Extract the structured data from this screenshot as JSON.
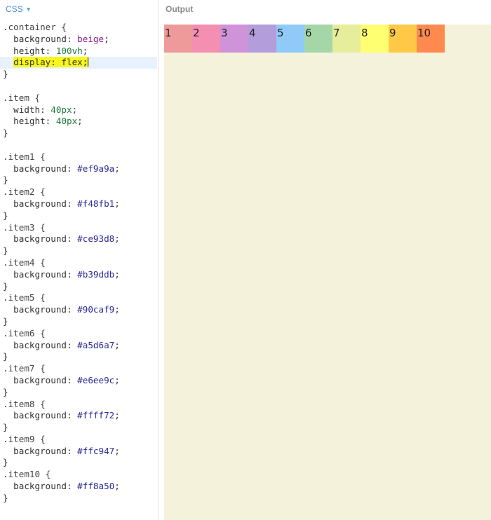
{
  "editor": {
    "tab_label": "CSS",
    "lines": [
      [
        {
          "t": ".container {",
          "c": "sel"
        }
      ],
      [
        {
          "t": "  background: ",
          "c": "prop"
        },
        {
          "t": "beige",
          "c": "val"
        },
        {
          "t": ";",
          "c": "prop"
        }
      ],
      [
        {
          "t": "  height: ",
          "c": "prop"
        },
        {
          "t": "100vh",
          "c": "num"
        },
        {
          "t": ";",
          "c": "prop"
        }
      ],
      [
        {
          "t": "  display: flex;",
          "c": "prop",
          "hl": true
        }
      ],
      [
        {
          "t": "}",
          "c": "prop"
        }
      ],
      [],
      [
        {
          "t": ".item {",
          "c": "sel"
        }
      ],
      [
        {
          "t": "  width: ",
          "c": "prop"
        },
        {
          "t": "40px",
          "c": "num"
        },
        {
          "t": ";",
          "c": "prop"
        }
      ],
      [
        {
          "t": "  height: ",
          "c": "prop"
        },
        {
          "t": "40px",
          "c": "num"
        },
        {
          "t": ";",
          "c": "prop"
        }
      ],
      [
        {
          "t": "}",
          "c": "prop"
        }
      ],
      [],
      [
        {
          "t": ".item1 {",
          "c": "sel"
        }
      ],
      [
        {
          "t": "  background: ",
          "c": "prop"
        },
        {
          "t": "#ef9a9a",
          "c": "hex"
        },
        {
          "t": ";",
          "c": "prop"
        }
      ],
      [
        {
          "t": "}",
          "c": "prop"
        }
      ],
      [
        {
          "t": ".item2 {",
          "c": "sel"
        }
      ],
      [
        {
          "t": "  background: ",
          "c": "prop"
        },
        {
          "t": "#f48fb1",
          "c": "hex"
        },
        {
          "t": ";",
          "c": "prop"
        }
      ],
      [
        {
          "t": "}",
          "c": "prop"
        }
      ],
      [
        {
          "t": ".item3 {",
          "c": "sel"
        }
      ],
      [
        {
          "t": "  background: ",
          "c": "prop"
        },
        {
          "t": "#ce93d8",
          "c": "hex"
        },
        {
          "t": ";",
          "c": "prop"
        }
      ],
      [
        {
          "t": "}",
          "c": "prop"
        }
      ],
      [
        {
          "t": ".item4 {",
          "c": "sel"
        }
      ],
      [
        {
          "t": "  background: ",
          "c": "prop"
        },
        {
          "t": "#b39ddb",
          "c": "hex"
        },
        {
          "t": ";",
          "c": "prop"
        }
      ],
      [
        {
          "t": "}",
          "c": "prop"
        }
      ],
      [
        {
          "t": ".item5 {",
          "c": "sel"
        }
      ],
      [
        {
          "t": "  background: ",
          "c": "prop"
        },
        {
          "t": "#90caf9",
          "c": "hex"
        },
        {
          "t": ";",
          "c": "prop"
        }
      ],
      [
        {
          "t": "}",
          "c": "prop"
        }
      ],
      [
        {
          "t": ".item6 {",
          "c": "sel"
        }
      ],
      [
        {
          "t": "  background: ",
          "c": "prop"
        },
        {
          "t": "#a5d6a7",
          "c": "hex"
        },
        {
          "t": ";",
          "c": "prop"
        }
      ],
      [
        {
          "t": "}",
          "c": "prop"
        }
      ],
      [
        {
          "t": ".item7 {",
          "c": "sel"
        }
      ],
      [
        {
          "t": "  background: ",
          "c": "prop"
        },
        {
          "t": "#e6ee9c",
          "c": "hex"
        },
        {
          "t": ";",
          "c": "prop"
        }
      ],
      [
        {
          "t": "}",
          "c": "prop"
        }
      ],
      [
        {
          "t": ".item8 {",
          "c": "sel"
        }
      ],
      [
        {
          "t": "  background: ",
          "c": "prop"
        },
        {
          "t": "#ffff72",
          "c": "hex"
        },
        {
          "t": ";",
          "c": "prop"
        }
      ],
      [
        {
          "t": "}",
          "c": "prop"
        }
      ],
      [
        {
          "t": ".item9 {",
          "c": "sel"
        }
      ],
      [
        {
          "t": "  background: ",
          "c": "prop"
        },
        {
          "t": "#ffc947",
          "c": "hex"
        },
        {
          "t": ";",
          "c": "prop"
        }
      ],
      [
        {
          "t": "}",
          "c": "prop"
        }
      ],
      [
        {
          "t": ".item10 {",
          "c": "sel"
        }
      ],
      [
        {
          "t": "  background: ",
          "c": "prop"
        },
        {
          "t": "#ff8a50",
          "c": "hex"
        },
        {
          "t": ";",
          "c": "prop"
        }
      ],
      [
        {
          "t": "}",
          "c": "prop"
        }
      ]
    ],
    "active_line": 3
  },
  "output": {
    "label": "Output",
    "background": "#f4f2da",
    "items": [
      {
        "label": "1",
        "color": "#ef9a9a"
      },
      {
        "label": "2",
        "color": "#f48fb1"
      },
      {
        "label": "3",
        "color": "#ce93d8"
      },
      {
        "label": "4",
        "color": "#b39ddb"
      },
      {
        "label": "5",
        "color": "#90caf9"
      },
      {
        "label": "6",
        "color": "#a5d6a7"
      },
      {
        "label": "7",
        "color": "#e6ee9c"
      },
      {
        "label": "8",
        "color": "#ffff72"
      },
      {
        "label": "9",
        "color": "#ffc947"
      },
      {
        "label": "10",
        "color": "#ff8a50"
      }
    ]
  }
}
